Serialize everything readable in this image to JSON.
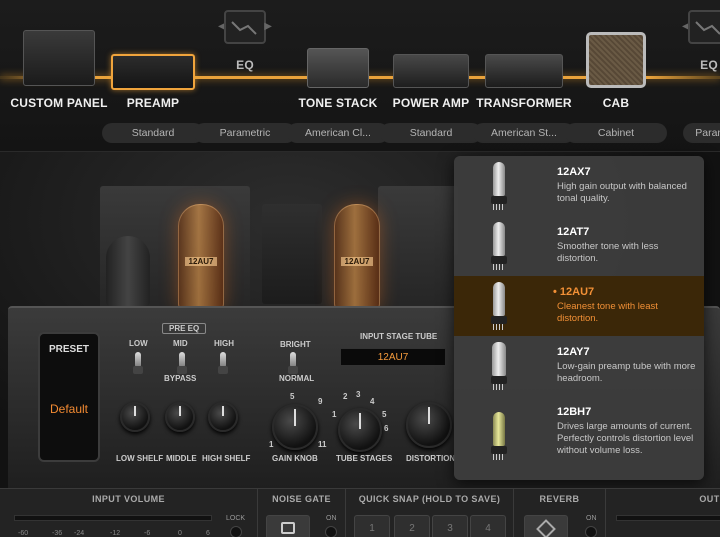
{
  "chain": {
    "modules": [
      {
        "label": "CUSTOM PANEL",
        "pill": ""
      },
      {
        "label": "PREAMP",
        "pill": "Standard"
      },
      {
        "label": "EQ",
        "pill": "Parametric"
      },
      {
        "label": "TONE STACK",
        "pill": "American Cl..."
      },
      {
        "label": "POWER AMP",
        "pill": "Standard"
      },
      {
        "label": "TRANSFORMER",
        "pill": "American St..."
      },
      {
        "label": "CAB",
        "pill": "Cabinet"
      },
      {
        "label": "EQ",
        "pill": "Parametri"
      }
    ],
    "accent": "#e9a23b"
  },
  "amp": {
    "tube_labels": [
      "12AU7",
      "12AU7"
    ],
    "preset_title": "PRESET",
    "preset_value": "Default",
    "pre_eq": "PRE EQ",
    "eq_low": "LOW",
    "eq_mid": "MID",
    "eq_high": "HIGH",
    "bypass": "BYPASS",
    "low_shelf": "LOW SHELF",
    "middle": "MIDDLE",
    "high_shelf": "HIGH SHELF",
    "bright": "BRIGHT",
    "normal": "NORMAL",
    "input_stage_tube": "INPUT STAGE TUBE",
    "input_stage_value": "12AU7",
    "gain_knob": "GAIN KNOB",
    "tube_stages": "TUBE STAGES",
    "distortion": "DISTORTION",
    "gain_scale": [
      "1",
      "5",
      "9",
      "11"
    ],
    "stage_scale": [
      "2",
      "3",
      "4",
      "5",
      "1",
      "6"
    ]
  },
  "tube_menu": {
    "items": [
      {
        "name": "12AX7",
        "desc": "High gain output with balanced tonal quality."
      },
      {
        "name": "12AT7",
        "desc": "Smoother tone with less distortion."
      },
      {
        "name": "• 12AU7",
        "desc": "Cleanest tone with least distortion."
      },
      {
        "name": "12AY7",
        "desc": "Low-gain preamp tube with more headroom."
      },
      {
        "name": "12BH7",
        "desc": "Drives large amounts of current. Perfectly controls distortion level without volume loss."
      }
    ],
    "selected_color": "#f29036"
  },
  "bottom": {
    "input_volume": "INPUT VOLUME",
    "noise_gate": "NOISE GATE",
    "quick_snap": "QUICK SNAP (HOLD TO SAVE)",
    "reverb": "REVERB",
    "output": "OUTP",
    "meter_ticks": [
      "-60",
      "-36",
      "-24",
      "-12",
      "-6",
      "0",
      "6"
    ],
    "lock": "LOCK",
    "on": "ON",
    "on2": "ON",
    "snap_slots": [
      "1",
      "2",
      "3",
      "4"
    ]
  }
}
